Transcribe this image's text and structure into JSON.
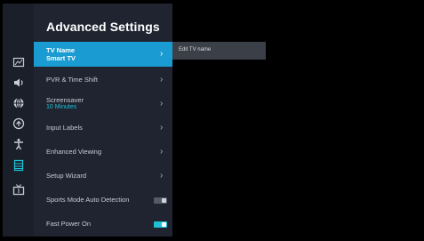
{
  "panel": {
    "title": "Advanced Settings",
    "items": [
      {
        "label": "TV Name",
        "sub": "Smart TV",
        "chevron": true,
        "selected": true
      },
      {
        "label": "PVR & Time Shift",
        "chevron": true
      },
      {
        "label": "Screensaver",
        "sub": "10 Minutes",
        "sub_color": "#1ec0d6",
        "chevron": true
      },
      {
        "label": "Input Labels",
        "chevron": true
      },
      {
        "label": "Enhanced Viewing",
        "chevron": true
      },
      {
        "label": "Setup Wizard",
        "chevron": true
      },
      {
        "label": "Sports Mode Auto Detection",
        "toggle": "off"
      },
      {
        "label": "Fast Power On",
        "toggle": "on"
      }
    ]
  },
  "edit": {
    "placeholder": "Edit TV name"
  },
  "rail": {
    "icons": [
      "picture-icon",
      "sound-icon",
      "network-icon",
      "app-icon",
      "accessibility-icon",
      "system-icon",
      "channel-icon"
    ],
    "active_index": 5
  },
  "colors": {
    "accent": "#1a9bd1",
    "highlight": "#1ec0d6",
    "panel": "#1f2430",
    "rail": "#1a1f29"
  }
}
